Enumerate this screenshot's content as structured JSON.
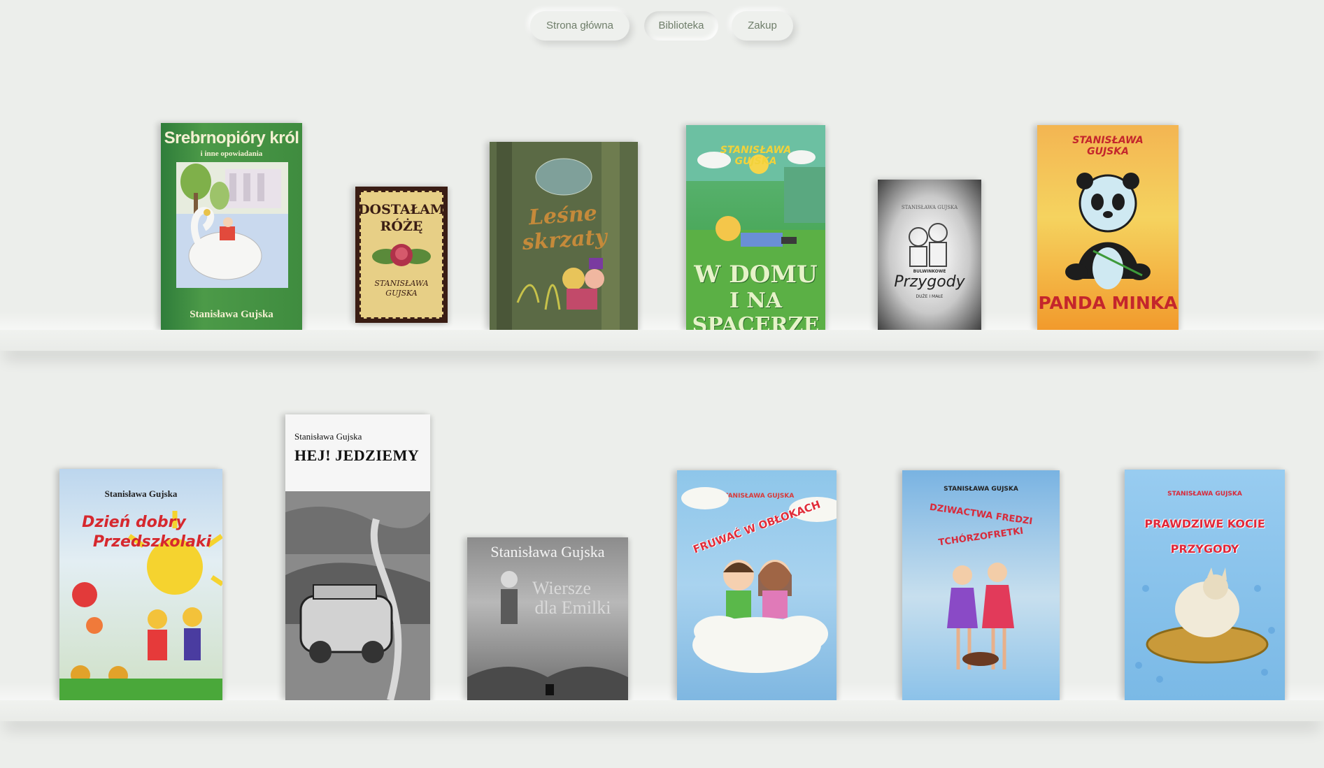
{
  "nav": {
    "items": [
      {
        "label": "Strona główna",
        "active": false
      },
      {
        "label": "Biblioteka",
        "active": true
      },
      {
        "label": "Zakup",
        "active": false
      }
    ]
  },
  "shelves": [
    {
      "books": [
        {
          "title": "Srebrnopióry król",
          "subtitle": "i inne opowiadania",
          "author": "Stanisława Gujska"
        },
        {
          "title_line1": "DOSTAŁAM",
          "title_line2": "RÓŻĘ",
          "author_line1": "STANISŁAWA",
          "author_line2": "GUJSKA"
        },
        {
          "title": "Leśne skrzaty"
        },
        {
          "author_line1": "STANISŁAWA",
          "author_line2": "GUJSKA",
          "title_line1": "W DOMU",
          "title_line2": "I NA SPACERZE"
        },
        {
          "author": "STANISŁAWA GUJSKA",
          "pretitle": "BULWINKOWE",
          "title": "Przygody",
          "subtitle": "DUŻE I MAŁE"
        },
        {
          "author_line1": "STANISŁAWA",
          "author_line2": "GUJSKA",
          "title": "PANDA MINKA"
        }
      ]
    },
    {
      "books": [
        {
          "author": "Stanisława Gujska",
          "title_line1": "Dzień dobry",
          "title_line2": "Przedszkolaki"
        },
        {
          "author": "Stanisława Gujska",
          "title": "HEJ! JEDZIEMY"
        },
        {
          "author": "Stanisława Gujska",
          "title_line1": "Wiersze",
          "title_line2": "dla Emilki"
        },
        {
          "author": "STANISŁAWA GUJSKA",
          "title": "FRUWAĆ W OBŁOKACH"
        },
        {
          "author": "STANISŁAWA GUJSKA",
          "title_line1": "DZIWACTWA FREDZI",
          "title_line2": "TCHÓRZOFRETKI"
        },
        {
          "author": "STANISŁAWA GUJSKA",
          "title_line1": "PRAWDZIWE KOCIE",
          "title_line2": "PRZYGODY"
        }
      ]
    }
  ],
  "colors": {
    "background": "#eceeeb",
    "nav_text": "#6f7e6a"
  }
}
